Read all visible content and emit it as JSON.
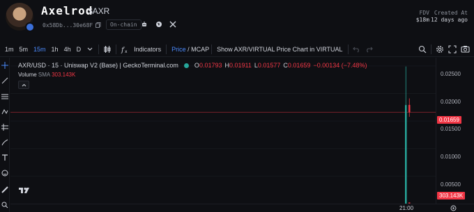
{
  "header": {
    "token_name": "Axelrod",
    "token_symbol": "$AXR",
    "address_short": "0x58Db...30e68F",
    "chain_label": "On-chain",
    "stats": [
      {
        "label": "FDV",
        "value": "$18m"
      },
      {
        "label": "Created At",
        "value": "12 days ago"
      }
    ],
    "social_icons": [
      "bot-icon",
      "globe-icon",
      "x-icon"
    ]
  },
  "toolbar": {
    "intervals": [
      "1m",
      "5m",
      "15m",
      "1h",
      "4h",
      "D"
    ],
    "active_interval": "15m",
    "indicators_label": "Indicators",
    "price_label": "Price",
    "mcap_label": " / MCAP",
    "show_pair_label": "Show AXR/VIRTUAL Price Chart in VIRTUAL"
  },
  "legend": {
    "pair": "AXR/USD · 15 · Uniswap V2 (Base) | GeckoTerminal.com",
    "o_label": "O",
    "o_value": "0.01793",
    "h_label": "H",
    "h_value": "0.01911",
    "l_label": "L",
    "l_value": "0.01577",
    "c_label": "C",
    "c_value": "0.01659",
    "change": "−0.00134 (−7.48%)",
    "volume_label": "Volume",
    "sma_label": "SMA",
    "volume_value": "303.143K"
  },
  "price_axis": {
    "ticks": [
      "0.02500",
      "0.02000",
      "0.01500",
      "0.01000",
      "0.00500"
    ],
    "current_price": "0.01659",
    "current_volume": "303.143K"
  },
  "time_axis": {
    "labels": [
      "21:00"
    ]
  },
  "colors": {
    "up": "#26a69a",
    "down": "#f23645",
    "accent": "#4c8cff",
    "background": "#0e0f13"
  },
  "chart_data": {
    "type": "candlestick",
    "ylim": [
      0,
      0.0265
    ],
    "candles": [
      {
        "o": 5e-05,
        "h": 0.0249,
        "l": 5e-05,
        "c": 0.0179,
        "dir": "up"
      },
      {
        "o": 0.01793,
        "h": 0.01911,
        "l": 0.01577,
        "c": 0.01659,
        "dir": "down"
      }
    ],
    "volumes": [
      {
        "v": 4500000,
        "dir": "up"
      },
      {
        "v": 303143,
        "dir": "down"
      }
    ],
    "x_label": "21:00"
  }
}
